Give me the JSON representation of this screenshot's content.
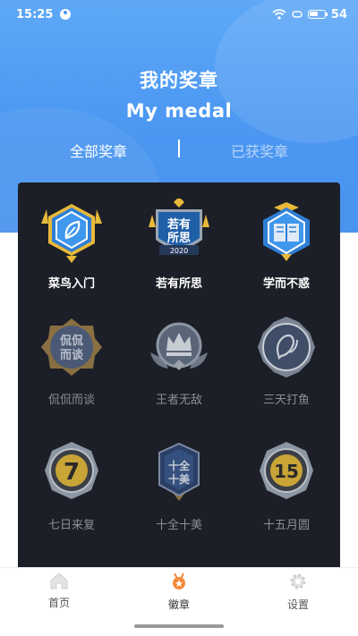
{
  "status_bar": {
    "time": "15:25",
    "battery_text": "54",
    "battery_level": 0.54
  },
  "header": {
    "title_cn": "我的奖章",
    "title_en": "My medal"
  },
  "tabs": [
    {
      "label": "全部奖章",
      "active": true
    },
    {
      "label": "已获奖章",
      "active": false
    }
  ],
  "badges": [
    {
      "label": "菜鸟入门",
      "earned": true,
      "icon": "leaf-badge-icon"
    },
    {
      "label": "若有所思",
      "earned": true,
      "icon": "thinking-badge-icon",
      "emblem_text": "若有",
      "emblem_text2": "所思",
      "ribbon_text": "2020"
    },
    {
      "label": "学而不惑",
      "earned": true,
      "icon": "book-badge-icon"
    },
    {
      "label": "侃侃而谈",
      "earned": false,
      "icon": "talk-badge-icon",
      "emblem_text": "侃侃",
      "emblem_text2": "而谈"
    },
    {
      "label": "王者无敌",
      "earned": false,
      "icon": "crown-badge-icon"
    },
    {
      "label": "三天打鱼",
      "earned": false,
      "icon": "fish-badge-icon"
    },
    {
      "label": "七日来复",
      "earned": false,
      "icon": "seven-days-badge-icon",
      "emblem_text": "7"
    },
    {
      "label": "十全十美",
      "earned": false,
      "icon": "perfect-ten-badge-icon",
      "emblem_text": "十全",
      "emblem_text2": "十美"
    },
    {
      "label": "十五月圆",
      "earned": false,
      "icon": "fifteen-badge-icon",
      "emblem_text": "15"
    }
  ],
  "bottom_nav": [
    {
      "label": "首页",
      "icon": "home-icon",
      "active": false
    },
    {
      "label": "徽章",
      "icon": "medal-icon",
      "active": true
    },
    {
      "label": "设置",
      "icon": "gear-icon",
      "active": false
    }
  ],
  "colors": {
    "header_blue": "#4b97f2",
    "panel_bg": "#1c1f27",
    "accent_orange": "#f5893a",
    "badge_gold": "#e8b93a",
    "badge_blue": "#2e7ed6"
  }
}
